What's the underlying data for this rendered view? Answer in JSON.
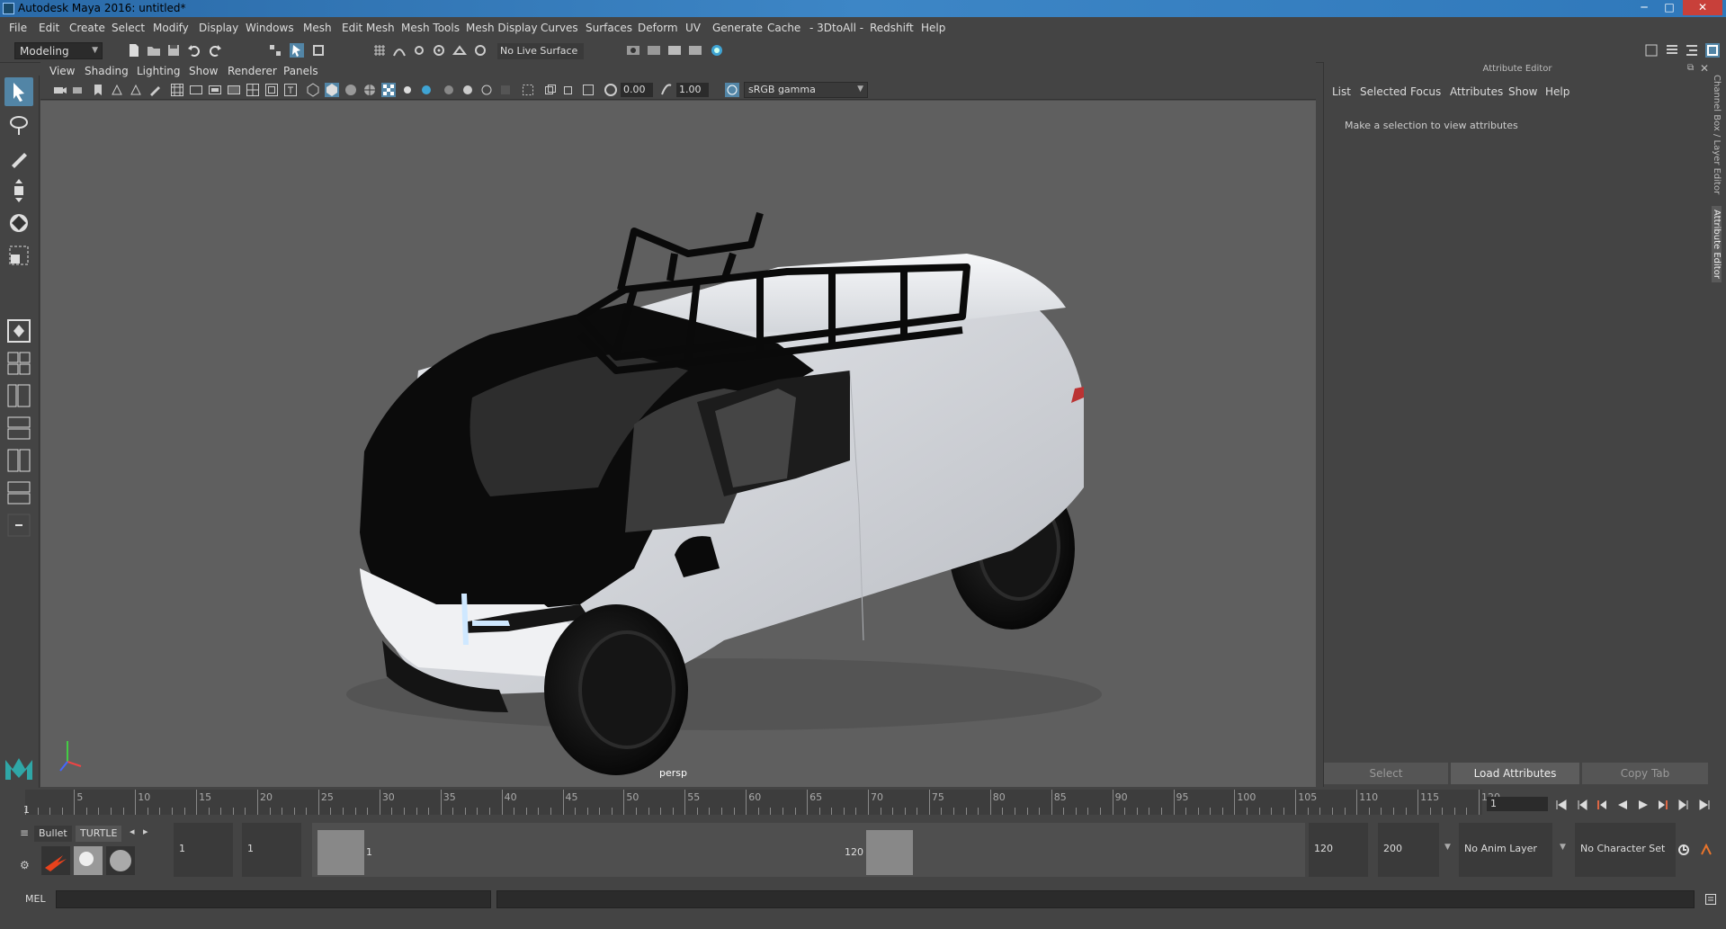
{
  "window": {
    "title": "Autodesk Maya 2016: untitled*",
    "minimize": "─",
    "maximize": "□",
    "close": "✕"
  },
  "menubar": [
    "File",
    "Edit",
    "Create",
    "Select",
    "Modify",
    "Display",
    "Windows",
    "Mesh",
    "Edit Mesh",
    "Mesh Tools",
    "Mesh Display",
    "Curves",
    "Surfaces",
    "Deform",
    "UV",
    "Generate",
    "Cache",
    "- 3DtoAll -",
    "Redshift",
    "Help"
  ],
  "shelf": {
    "mode": "Modeling",
    "live_surface": "No Live Surface"
  },
  "viewport": {
    "menu": [
      "View",
      "Shading",
      "Lighting",
      "Show",
      "Renderer",
      "Panels"
    ],
    "exposure": "0.00",
    "gamma_value": "1.00",
    "color_space": "sRGB gamma",
    "camera_label": "persp"
  },
  "attribute_editor": {
    "title": "Attribute Editor",
    "menu": [
      "List",
      "Selected",
      "Focus",
      "Attributes",
      "Show",
      "Help"
    ],
    "message": "Make a selection to view attributes",
    "buttons": [
      "Select",
      "Load Attributes",
      "Copy Tab"
    ]
  },
  "side_tabs": [
    "Channel Box / Layer Editor",
    "Attribute Editor"
  ],
  "timeline": {
    "ticks": [
      "5",
      "10",
      "15",
      "20",
      "25",
      "30",
      "35",
      "40",
      "45",
      "50",
      "55",
      "60",
      "65",
      "70",
      "75",
      "80",
      "85",
      "90",
      "95",
      "100",
      "105",
      "110",
      "115",
      "120"
    ],
    "start_marker": "1",
    "current_frame": "1"
  },
  "range": {
    "shelf_tabs": [
      "Bullet",
      "TURTLE"
    ],
    "start": "1",
    "playback_start": "1",
    "slider_start": "1",
    "slider_end": "120",
    "playback_end": "120",
    "end": "200",
    "anim_layer": "No Anim Layer",
    "character_set": "No Character Set"
  },
  "command_line": {
    "label": "MEL"
  },
  "colors": {
    "accent": "#5285a6",
    "title_blue": "#3d86c6",
    "viewport_bg": "#5f5f5f",
    "panel": "#444444",
    "close_red": "#c8403a"
  }
}
